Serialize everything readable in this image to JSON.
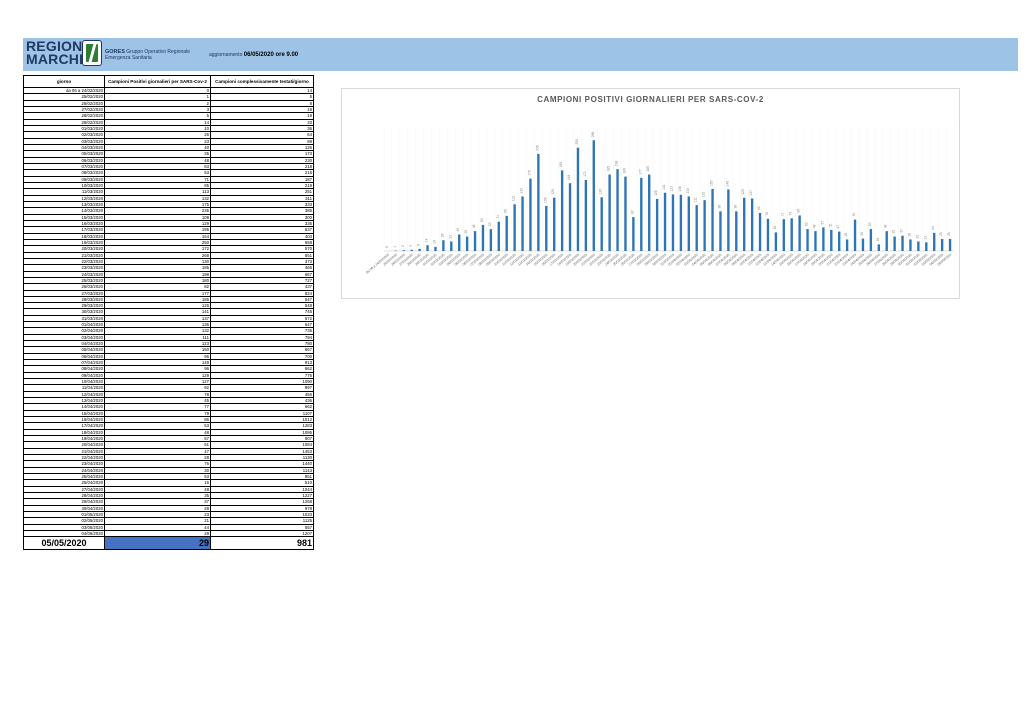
{
  "header": {
    "brand_line1": "REGIONE",
    "brand_line2": "MARCHE",
    "org_name": "GORES",
    "org_desc1": "Gruppo Operativo Regionale",
    "org_desc2": "Emergenza Sanitaria",
    "update_label": "aggiornamento",
    "update_value": "06/05/2020 ore 9.00",
    "logo_icon": "regione-marche-logo-icon"
  },
  "table": {
    "headers": [
      "giorno",
      "Campioni Positivi giornalieri per SARS-Cov-2",
      "Campioni complessivamente testati/giorno"
    ],
    "rows": [
      [
        "da 06 a 24/02/2020",
        "0",
        "14"
      ],
      [
        "25/02/2020",
        "1",
        "5"
      ],
      [
        "26/02/2020",
        "2",
        "8"
      ],
      [
        "27/02/2020",
        "3",
        "19"
      ],
      [
        "28/02/2020",
        "5",
        "19"
      ],
      [
        "29/02/2020",
        "14",
        "33"
      ],
      [
        "01/03/2020",
        "10",
        "36"
      ],
      [
        "02/03/2020",
        "26",
        "64"
      ],
      [
        "03/03/2020",
        "23",
        "89"
      ],
      [
        "04/03/2020",
        "40",
        "126"
      ],
      [
        "05/03/2020",
        "35",
        "173"
      ],
      [
        "06/03/2020",
        "48",
        "230"
      ],
      [
        "07/03/2020",
        "63",
        "218"
      ],
      [
        "08/03/2020",
        "53",
        "216"
      ],
      [
        "09/03/2020",
        "71",
        "187"
      ],
      [
        "10/03/2020",
        "85",
        "219"
      ],
      [
        "11/03/2020",
        "113",
        "251"
      ],
      [
        "12/03/2020",
        "132",
        "311"
      ],
      [
        "13/03/2020",
        "175",
        "333"
      ],
      [
        "14/03/2020",
        "235",
        "386"
      ],
      [
        "15/03/2020",
        "109",
        "300"
      ],
      [
        "16/03/2020",
        "129",
        "335"
      ],
      [
        "17/03/2020",
        "195",
        "537"
      ],
      [
        "18/03/2020",
        "164",
        "403"
      ],
      [
        "19/03/2020",
        "250",
        "658"
      ],
      [
        "20/03/2020",
        "172",
        "570"
      ],
      [
        "21/03/2020",
        "268",
        "651"
      ],
      [
        "22/03/2020",
        "130",
        "373"
      ],
      [
        "23/03/2020",
        "185",
        "465"
      ],
      [
        "24/03/2020",
        "198",
        "667"
      ],
      [
        "25/03/2020",
        "180",
        "727"
      ],
      [
        "26/03/2020",
        "82",
        "437"
      ],
      [
        "27/03/2020",
        "177",
        "824"
      ],
      [
        "28/03/2020",
        "185",
        "547"
      ],
      [
        "29/03/2020",
        "126",
        "548"
      ],
      [
        "30/03/2020",
        "141",
        "745"
      ],
      [
        "31/03/2020",
        "137",
        "572"
      ],
      [
        "01/04/2020",
        "136",
        "647"
      ],
      [
        "02/04/2020",
        "132",
        "735"
      ],
      [
        "03/04/2020",
        "111",
        "794"
      ],
      [
        "04/04/2020",
        "123",
        "780"
      ],
      [
        "05/04/2020",
        "150",
        "667"
      ],
      [
        "06/04/2020",
        "96",
        "700"
      ],
      [
        "07/04/2020",
        "149",
        "913"
      ],
      [
        "08/04/2020",
        "96",
        "662"
      ],
      [
        "09/04/2020",
        "129",
        "776"
      ],
      [
        "10/04/2020",
        "127",
        "1090"
      ],
      [
        "11/04/2020",
        "92",
        "997"
      ],
      [
        "12/04/2020",
        "78",
        "456"
      ],
      [
        "13/04/2020",
        "45",
        "436"
      ],
      [
        "14/04/2020",
        "77",
        "662"
      ],
      [
        "15/04/2020",
        "79",
        "1107"
      ],
      [
        "16/04/2020",
        "86",
        "1012"
      ],
      [
        "17/04/2020",
        "53",
        "1283"
      ],
      [
        "18/04/2020",
        "48",
        "1086"
      ],
      [
        "19/04/2020",
        "57",
        "907"
      ],
      [
        "20/04/2020",
        "51",
        "1084"
      ],
      [
        "21/04/2020",
        "47",
        "1453"
      ],
      [
        "22/04/2020",
        "28",
        "1130"
      ],
      [
        "23/04/2020",
        "76",
        "1440"
      ],
      [
        "24/04/2020",
        "30",
        "1143"
      ],
      [
        "25/04/2020",
        "53",
        "851"
      ],
      [
        "26/04/2020",
        "16",
        "510"
      ],
      [
        "27/04/2020",
        "48",
        "1044"
      ],
      [
        "28/04/2020",
        "35",
        "1227"
      ],
      [
        "29/04/2020",
        "37",
        "1268"
      ],
      [
        "30/04/2020",
        "28",
        "978"
      ],
      [
        "01/05/2020",
        "23",
        "1033"
      ],
      [
        "02/05/2020",
        "21",
        "1125"
      ],
      [
        "03/05/2020",
        "44",
        "557"
      ],
      [
        "04/05/2020",
        "29",
        "1207"
      ]
    ],
    "total_row": [
      "05/05/2020",
      "29",
      "981"
    ],
    "colors": {
      "highlight": "#4472c4",
      "header_band": "#9dc3e6"
    }
  },
  "chart_data": {
    "type": "bar",
    "title": "CAMPIONI POSITIVI GIORNALIERI PER SARS-COV-2",
    "categories": [
      "da 06 a 24/02/2020",
      "25/02/2020",
      "26/02/2020",
      "27/02/2020",
      "28/02/2020",
      "29/02/2020",
      "01/03/2020",
      "02/03/2020",
      "03/03/2020",
      "04/03/2020",
      "05/03/2020",
      "06/03/2020",
      "07/03/2020",
      "08/03/2020",
      "09/03/2020",
      "10/03/2020",
      "11/03/2020",
      "12/03/2020",
      "13/03/2020",
      "14/03/2020",
      "15/03/2020",
      "16/03/2020",
      "17/03/2020",
      "18/03/2020",
      "19/03/2020",
      "20/03/2020",
      "21/03/2020",
      "22/03/2020",
      "23/03/2020",
      "24/03/2020",
      "25/03/2020",
      "26/03/2020",
      "27/03/2020",
      "28/03/2020",
      "29/03/2020",
      "30/03/2020",
      "31/03/2020",
      "01/04/2020",
      "02/04/2020",
      "03/04/2020",
      "04/04/2020",
      "05/04/2020",
      "06/04/2020",
      "07/04/2020",
      "08/04/2020",
      "09/04/2020",
      "10/04/2020",
      "11/04/2020",
      "12/04/2020",
      "13/04/2020",
      "14/04/2020",
      "15/04/2020",
      "16/04/2020",
      "17/04/2020",
      "18/04/2020",
      "19/04/2020",
      "20/04/2020",
      "21/04/2020",
      "22/04/2020",
      "23/04/2020",
      "24/04/2020",
      "25/04/2020",
      "26/04/2020",
      "27/04/2020",
      "28/04/2020",
      "29/04/2020",
      "30/04/2020",
      "01/05/2020",
      "02/05/2020",
      "03/05/2020",
      "04/05/2020",
      "05/05/2020"
    ],
    "values": [
      0,
      1,
      2,
      3,
      5,
      14,
      10,
      26,
      23,
      40,
      35,
      48,
      63,
      53,
      71,
      85,
      113,
      132,
      175,
      235,
      109,
      129,
      195,
      164,
      250,
      172,
      268,
      130,
      185,
      198,
      180,
      82,
      177,
      185,
      126,
      141,
      137,
      136,
      132,
      111,
      123,
      150,
      96,
      149,
      96,
      129,
      127,
      92,
      78,
      45,
      77,
      79,
      86,
      53,
      48,
      57,
      51,
      47,
      28,
      76,
      30,
      53,
      16,
      48,
      35,
      37,
      28,
      23,
      21,
      44,
      29,
      29
    ],
    "ylim": [
      0,
      300
    ],
    "grid": true,
    "bar_color": "#2e75b6",
    "data_labels": true
  }
}
